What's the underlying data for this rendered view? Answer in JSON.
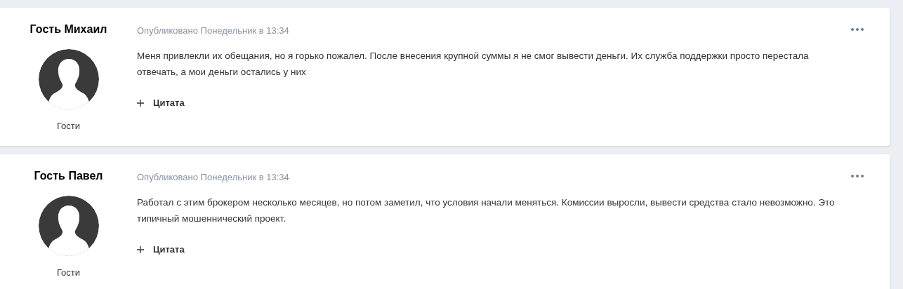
{
  "posts": [
    {
      "author": "Гость Михаил",
      "group": "Гости",
      "meta": "Опубликовано Понедельник в 13:34",
      "body": "Меня привлекли их обещания, но я горько пожалел. После внесения крупной суммы я не смог вывести деньги. Их служба поддержки просто перестала отвечать, а мои деньги остались у них",
      "quote_label": "Цитата"
    },
    {
      "author": "Гость Павел",
      "group": "Гости",
      "meta": "Опубликовано Понедельник в 13:34",
      "body": "Работал с этим брокером несколько месяцев, но потом заметил, что условия начали меняться. Комиссии выросли, вывести средства стало невозможно. Это типичный мошеннический проект.",
      "quote_label": "Цитата"
    }
  ]
}
